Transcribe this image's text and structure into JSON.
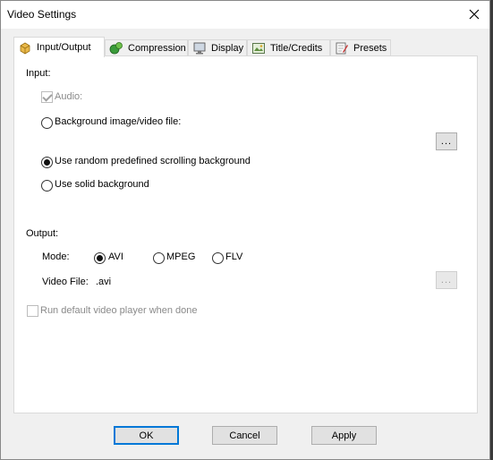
{
  "window": {
    "title": "Video Settings"
  },
  "tabs": [
    {
      "label": "Input/Output",
      "icon": "input-output-icon",
      "active": true
    },
    {
      "label": "Compression",
      "icon": "compression-icon",
      "active": false
    },
    {
      "label": "Display",
      "icon": "display-icon",
      "active": false
    },
    {
      "label": "Title/Credits",
      "icon": "title-credits-icon",
      "active": false
    },
    {
      "label": "Presets",
      "icon": "presets-icon",
      "active": false
    }
  ],
  "input": {
    "heading": "Input:",
    "audio_label": "Audio:",
    "audio_checked": true,
    "background_file_label": "Background image/video file:",
    "browse_label": "...",
    "random_bg_label": "Use random predefined scrolling background",
    "solid_bg_label": "Use solid background",
    "selected_background": "random"
  },
  "output": {
    "heading": "Output:",
    "mode_label": "Mode:",
    "modes": [
      "AVI",
      "MPEG",
      "FLV"
    ],
    "selected_mode": "AVI",
    "video_file_label": "Video File:",
    "video_file_value": ".avi",
    "browse_label": "...",
    "run_player_label": "Run default video player when done",
    "run_player_checked": false
  },
  "buttons": {
    "ok": "OK",
    "cancel": "Cancel",
    "apply": "Apply"
  },
  "colors": {
    "accent": "#0078d7",
    "panel": "#ffffff",
    "chrome": "#f0f0f0"
  }
}
